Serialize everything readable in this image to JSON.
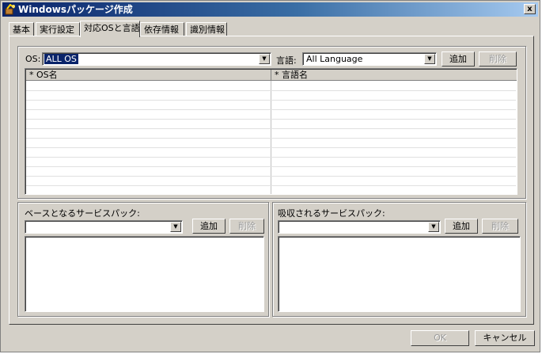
{
  "window": {
    "title": "Windowsパッケージ作成",
    "close_label": "x"
  },
  "tabs": [
    {
      "label": "基本"
    },
    {
      "label": "実行設定"
    },
    {
      "label": "対応OSと言語",
      "active": true
    },
    {
      "label": "依存情報"
    },
    {
      "label": "識別情報"
    }
  ],
  "os_section": {
    "os_label": "OS:",
    "os_value": "ALL OS",
    "language_label": "言語:",
    "language_value": "All Language",
    "add_label": "追加",
    "delete_label": "削除",
    "table": {
      "headers": [
        "* OS名",
        "* 言語名"
      ],
      "rows": []
    }
  },
  "base_sp": {
    "label": "ベースとなるサービスパック:",
    "value": "",
    "add_label": "追加",
    "delete_label": "削除",
    "items": []
  },
  "absorbed_sp": {
    "label": "吸収されるサービスパック:",
    "value": "",
    "add_label": "追加",
    "delete_label": "削除",
    "items": []
  },
  "footer": {
    "ok_label": "OK",
    "cancel_label": "キャンセル"
  },
  "colors": {
    "titlebar_start": "#0a246a",
    "titlebar_end": "#a6caf0",
    "face": "#d4d0c8",
    "selection": "#0a246a"
  }
}
